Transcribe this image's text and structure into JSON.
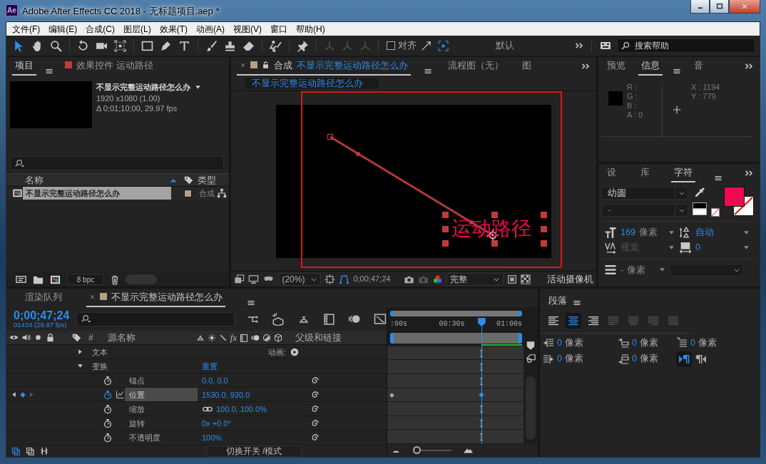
{
  "window": {
    "app_badge": "Ae",
    "title": "Adobe After Effects CC 2018 - 无标题项目.aep *"
  },
  "menu": [
    "文件(F)",
    "编辑(E)",
    "合成(C)",
    "图层(L)",
    "效果(T)",
    "动画(A)",
    "视图(V)",
    "窗口",
    "帮助(H)"
  ],
  "toolbar": {
    "tools": [
      {
        "kind": "select",
        "selected": true
      },
      {
        "kind": "hand",
        "selected": false
      },
      {
        "kind": "zoom",
        "selected": false
      },
      {
        "kind": "rotate",
        "selected": false
      },
      {
        "kind": "camera",
        "selected": false
      },
      {
        "kind": "pan",
        "selected": false
      },
      {
        "kind": "rect",
        "selected": false
      },
      {
        "kind": "pen",
        "selected": false
      },
      {
        "kind": "text",
        "selected": false
      },
      {
        "kind": "brush",
        "selected": false
      },
      {
        "kind": "stamp",
        "selected": false
      },
      {
        "kind": "eraser",
        "selected": false
      },
      {
        "kind": "roto",
        "selected": false
      },
      {
        "kind": "pin",
        "selected": false
      }
    ],
    "snap": {
      "label": "对齐",
      "checked": false
    },
    "workspace": "默认",
    "search": {
      "placeholder": "搜索帮助"
    }
  },
  "project": {
    "tabs": [
      {
        "kind": "panel",
        "label": "项目",
        "selected": true
      },
      {
        "kind": "effects",
        "label": "效果控件 运动路径",
        "selected": false
      }
    ],
    "comp": {
      "name": "不显示完整运动路径怎么办",
      "size": "1920 x1080 (1.00)",
      "duration": "Δ 0;01;10;00, 29.97 fps"
    },
    "columns": [
      "名称",
      "类型"
    ],
    "items": [
      {
        "name": "不显示完整运动路径怎么办",
        "type": "合成",
        "selected": true
      }
    ],
    "bpc": "8 bpc"
  },
  "composition": {
    "tabs": [
      {
        "prefix": "合成",
        "label": "不显示完整运动路径怎么办",
        "selected": true
      },
      {
        "label": "流程图（无）",
        "selected": false
      },
      {
        "label": "图",
        "selected": false
      }
    ],
    "breadcrumb": "不显示完整运动路径怎么办",
    "layer_text": "运动路径",
    "zoom": "(20%)",
    "timecode": "0;00;47;24",
    "resolution": "完整",
    "camera": "活动摄像机"
  },
  "info": {
    "tabs": [
      {
        "label": "预览",
        "selected": false
      },
      {
        "label": "信息",
        "selected": true
      },
      {
        "label": "音",
        "selected": false
      }
    ],
    "channels": [
      {
        "label": "R :"
      },
      {
        "label": "G :"
      },
      {
        "label": "B :"
      },
      {
        "label": "A :",
        "value": "0"
      }
    ],
    "coords": [
      {
        "label": "X :",
        "value": "1194"
      },
      {
        "label": "Y :",
        "value": "779"
      }
    ]
  },
  "character": {
    "tabs": [
      {
        "label": "设",
        "selected": false
      },
      {
        "label": "库",
        "selected": false
      },
      {
        "label": "字符",
        "selected": true
      }
    ],
    "font": "幼圆",
    "style": "-",
    "metrics": [
      {
        "kind": "size",
        "value": "169",
        "unit": "像素",
        "disabled": false
      },
      {
        "kind": "leading",
        "value": "自动",
        "disabled": false
      },
      {
        "kind": "kerning",
        "value": "视觉",
        "disabled": true
      },
      {
        "kind": "tracking",
        "value": "0",
        "disabled": false
      }
    ],
    "stroke": {
      "value": "-",
      "unit": "像素"
    }
  },
  "timeline": {
    "tabs": [
      {
        "kind": "queue",
        "label": "渲染队列",
        "selected": false
      },
      {
        "kind": "comp",
        "label": "不显示完整运动路径怎么办",
        "selected": true
      }
    ],
    "timecode": "0;00;47;24",
    "frame_info": "01434 (29.97 fps)",
    "columns": [
      "#",
      "源名称",
      "fx",
      "父级和链接"
    ],
    "rows": [
      {
        "kind": "group",
        "label": "文本",
        "expanded": false,
        "action": "动画:",
        "selected": false
      },
      {
        "kind": "group",
        "label": "变换",
        "expanded": true,
        "value": "重置",
        "selected": false
      },
      {
        "kind": "property",
        "label": "锚点",
        "value": "0.0, 0.0",
        "keyframed": false,
        "linked": false,
        "selected": false
      },
      {
        "kind": "property",
        "label": "位置",
        "value": "1530.0, 930.0",
        "keyframed": true,
        "linked": false,
        "selected": true
      },
      {
        "kind": "property",
        "label": "缩放",
        "value": "100.0, 100.0%",
        "keyframed": false,
        "linked": true,
        "selected": false
      },
      {
        "kind": "property",
        "label": "旋转",
        "value": "0x +0.0°",
        "keyframed": false,
        "linked": false,
        "selected": false
      },
      {
        "kind": "property",
        "label": "不透明度",
        "value": "100%",
        "keyframed": false,
        "linked": false,
        "selected": false
      }
    ],
    "ruler": [
      ":00s",
      "00:30s",
      "01:00s"
    ],
    "zoom_slider": {
      "level": 0.05
    },
    "footer": "切换开关 /模式"
  },
  "paragraph": {
    "title": "段落",
    "align": [
      {
        "kind": "left",
        "selected": false
      },
      {
        "kind": "center",
        "selected": true
      },
      {
        "kind": "right",
        "selected": false
      },
      {
        "kind": "justify-left",
        "selected": false
      },
      {
        "kind": "justify-center",
        "selected": false
      },
      {
        "kind": "justify-right",
        "selected": false
      },
      {
        "kind": "justify-all",
        "selected": false
      }
    ],
    "spacing": [
      {
        "kind": "indent-left",
        "value": "0",
        "unit": "像素"
      },
      {
        "kind": "space-before",
        "value": "0",
        "unit": "像素"
      },
      {
        "kind": "indent-first",
        "value": "0",
        "unit": "像素"
      },
      {
        "kind": "indent-right",
        "value": "0",
        "unit": "像素"
      },
      {
        "kind": "space-after",
        "value": "0",
        "unit": "像素"
      }
    ],
    "direction": [
      {
        "kind": "ltr",
        "selected": true
      },
      {
        "kind": "rtl",
        "selected": false
      }
    ]
  }
}
